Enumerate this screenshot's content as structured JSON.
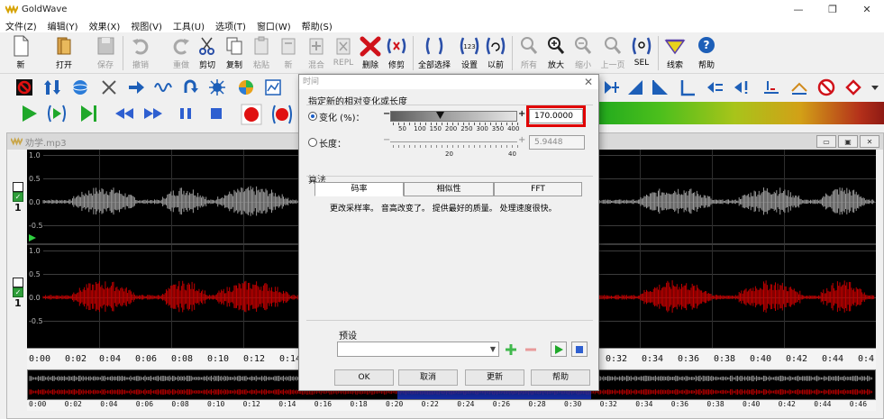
{
  "app": {
    "title": "GoldWave",
    "window_controls": [
      "—",
      "❐",
      "✕"
    ]
  },
  "menu": [
    "文件(Z)",
    "编辑(Y)",
    "效果(X)",
    "视图(V)",
    "工具(U)",
    "选项(T)",
    "窗口(W)",
    "帮助(S)"
  ],
  "toolbar": {
    "new": "新",
    "open": "打开",
    "save": "保存",
    "undo": "撤销",
    "redo": "重做",
    "cut": "剪切",
    "copy": "复制",
    "paste": "粘贴",
    "new2": "新",
    "mix": "混合",
    "repl": "REPL",
    "delete": "删除",
    "trim": "修剪",
    "select_all": "全部选择",
    "set": "设置",
    "previous": "以前",
    "all": "所有",
    "zoom_in": "放大",
    "zoom_out": "缩小",
    "prev_page": "上一页",
    "sel": "SEL",
    "cue": "线索",
    "help": "帮助"
  },
  "document": {
    "title": "劝学.mp3",
    "controls": [
      "▭",
      "▣",
      "✕"
    ],
    "channel1_labels": [
      "1.0",
      "0.5",
      "0.0",
      "-0.5"
    ],
    "channel2_labels": [
      "1.0",
      "0.5",
      "0.0",
      "-0.5"
    ],
    "channel_number": "1",
    "check_mark": "✓",
    "timeline": [
      "0:00",
      "0:02",
      "0:04",
      "0:06",
      "0:08",
      "0:10",
      "0:12",
      "0:14",
      "0:32",
      "0:34",
      "0:36",
      "0:38",
      "0:40",
      "0:42",
      "0:44",
      "0:4"
    ],
    "overview_timeline": [
      "0:00",
      "0:02",
      "0:04",
      "0:06",
      "0:08",
      "0:10",
      "0:12",
      "0:14",
      "0:16",
      "0:18",
      "0:20",
      "0:22",
      "0:24",
      "0:26",
      "0:28",
      "0:30",
      "0:32",
      "0:34",
      "0:36",
      "0:38",
      "0:40",
      "0:42",
      "0:44",
      "0:46"
    ],
    "waveform_color_top": "#9a9a9a",
    "waveform_color_bottom": "#c00000"
  },
  "dialog": {
    "title": "时间",
    "close": "✕",
    "group_title": "指定新的相对变化或长度",
    "change_label": "变化 (%)：",
    "change_value": "170.0000",
    "change_scale": [
      "50",
      "100",
      "150",
      "200",
      "250",
      "300",
      "350",
      "400"
    ],
    "length_label": "长度：",
    "length_value": "5.9448",
    "length_scale": [
      "20",
      "40"
    ],
    "minus": "−",
    "plus": "+",
    "algorithm_title": "算法",
    "tabs": [
      "码率",
      "相似性",
      "FFT"
    ],
    "description": "更改采样率。 音高改变了。 提供最好的质量。 处理速度很快。",
    "preset_label": "预设",
    "preset_value": "",
    "buttons": {
      "ok": "OK",
      "cancel": "取消",
      "update": "更新",
      "help": "帮助"
    }
  }
}
